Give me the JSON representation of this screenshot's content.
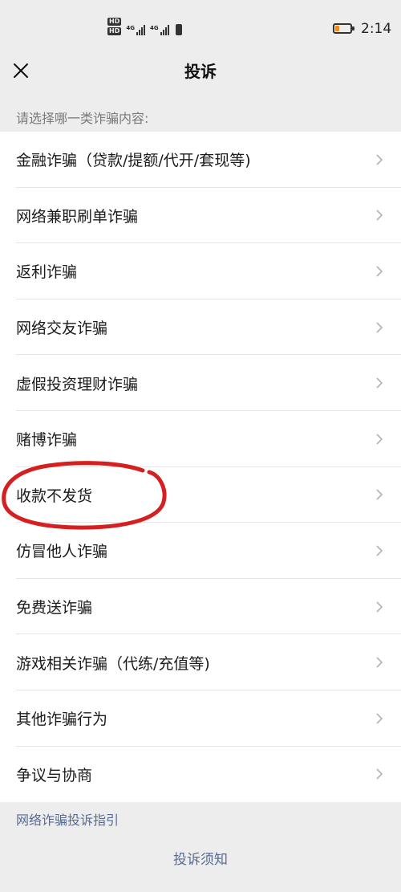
{
  "status_bar": {
    "hd1": "HD",
    "hd2": "HD",
    "net1": "4G",
    "net2": "4G",
    "battery_level": 0.25,
    "battery_color": "#f08c1f",
    "time": "2:14"
  },
  "nav": {
    "title": "投诉",
    "close_icon": "close-icon"
  },
  "section_title": "请选择哪一类诈骗内容:",
  "items": [
    {
      "label": "金融诈骗（贷款/提额/代开/套现等)"
    },
    {
      "label": "网络兼职刷单诈骗"
    },
    {
      "label": "返利诈骗"
    },
    {
      "label": "网络交友诈骗"
    },
    {
      "label": "虚假投资理财诈骗"
    },
    {
      "label": "赌博诈骗"
    },
    {
      "label": "收款不发货"
    },
    {
      "label": "仿冒他人诈骗"
    },
    {
      "label": "免费送诈骗"
    },
    {
      "label": "游戏相关诈骗（代练/充值等)"
    },
    {
      "label": "其他诈骗行为"
    },
    {
      "label": "争议与协商"
    }
  ],
  "footer": {
    "guide_link": "网络诈骗投诉指引",
    "notice_link": "投诉须知"
  },
  "colors": {
    "background": "#ededed",
    "link": "#576b95",
    "annotation": "#d42020"
  }
}
